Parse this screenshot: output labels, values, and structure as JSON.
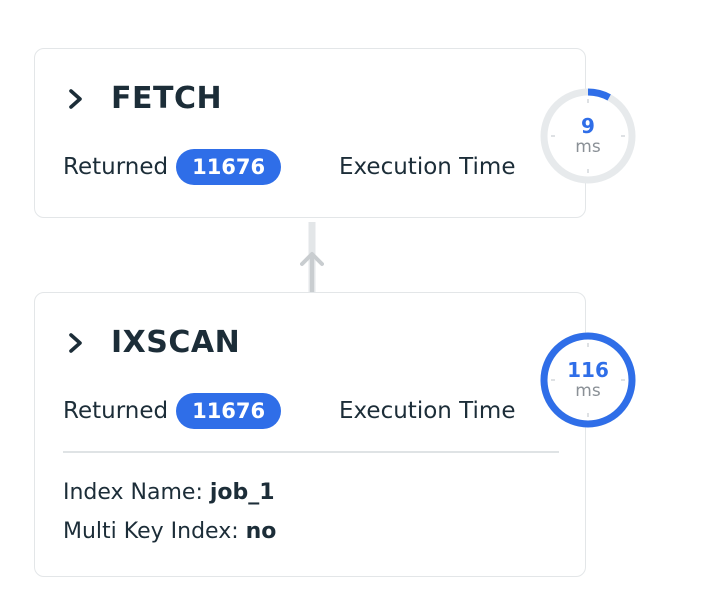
{
  "stages": [
    {
      "name": "FETCH",
      "returned_label": "Returned",
      "returned_count": "11676",
      "exec_label": "Execution Time",
      "time_value": "9",
      "time_unit": "ms",
      "time_fraction": 0.08
    },
    {
      "name": "IXSCAN",
      "returned_label": "Returned",
      "returned_count": "11676",
      "exec_label": "Execution Time",
      "time_value": "116",
      "time_unit": "ms",
      "time_fraction": 1.0,
      "details": {
        "index_name_label": "Index Name:",
        "index_name_value": "job_1",
        "multi_key_label": "Multi Key Index:",
        "multi_key_value": "no"
      }
    }
  ],
  "colors": {
    "accent": "#2f6ee8",
    "track": "#e7eaec",
    "text": "#1c2d38",
    "border": "#e3e6e8"
  },
  "icons": {
    "expand": "chevron-right-icon",
    "connector": "arrow-up-icon"
  }
}
